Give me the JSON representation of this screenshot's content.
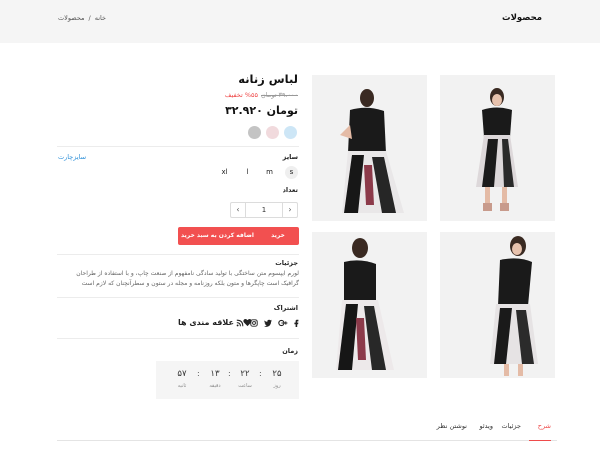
{
  "header": {
    "title": "محصولات",
    "breadcrumb": [
      "خانه",
      "/",
      "محصولات"
    ]
  },
  "product": {
    "name": "لباس زنانه",
    "old_price": "۳۹.۰۰۰ تومان",
    "discount": "%۵۵ تخفیف",
    "price": "۳۲.۹۲۰ تومان",
    "colors": [
      "#c4c4c4",
      "#f1dadd",
      "#cde6f6"
    ]
  },
  "size": {
    "label": "سایز",
    "chart_link": "سایزچارت",
    "options": [
      "s",
      "m",
      "l",
      "xl"
    ]
  },
  "quantity": {
    "label": "تعداد",
    "value": "1",
    "plus": "›",
    "minus": "‹"
  },
  "actions": {
    "buy": "خرید",
    "add_to_cart": "اضافه کردن به سبد خرید"
  },
  "details": {
    "label": "جزئیات",
    "text": "لورم ایپسوم متن ساختگی با تولید سادگی نامفهوم از صنعت چاپ، و با استفاده از طراحان گرافیک است چاپگرها و متون بلکه روزنامه و مجله در ستون و سطرآنچنان که لازم است"
  },
  "share": {
    "label": "اشتراک",
    "favorite": "علاقه مندی ها",
    "icons": [
      "rss-icon",
      "instagram-icon",
      "twitter-icon",
      "google-plus-icon",
      "facebook-icon"
    ]
  },
  "timer": {
    "label": "زمان",
    "days": "۲۵",
    "days_label": "روز",
    "hours": "۲۲",
    "hours_label": "ساعت",
    "minutes": "۱۳",
    "minutes_label": "دقیقه",
    "seconds": "۵۷",
    "seconds_label": "ثانیه",
    "sep": ":"
  },
  "tabs": [
    "شرح",
    "جزئیات",
    "ویدئو",
    "نوشتن نظر"
  ],
  "colors": {
    "accent": "#ef4b4b",
    "link": "#2c8fd8"
  }
}
